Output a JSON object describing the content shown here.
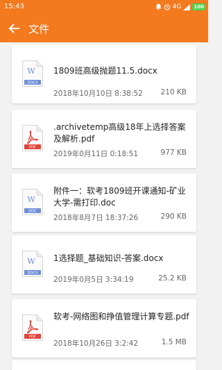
{
  "status_bar": {
    "time": "15:43",
    "network": "4G",
    "battery": "100"
  },
  "app_bar": {
    "title": "文件",
    "back_icon": "arrow-left-icon"
  },
  "colors": {
    "accent": "#f47a1f",
    "word_icon": "#6f8fd6",
    "pdf_icon": "#e0443a"
  },
  "files": [
    {
      "name": "1809班高级抛题11.5.docx",
      "date": "2018年10月10日 8:38:52",
      "size": "210 KB",
      "icon_type": "word",
      "icon_label": "DOCX"
    },
    {
      "name": ".archivetemp高级18年上选择答案及解析.pdf",
      "date": "2019年0月11日 0:18:51",
      "size": "977 KB",
      "icon_type": "pdf",
      "icon_label": "PDF"
    },
    {
      "name": "附件一：软考1809班开课通知-矿业大学-需打印.doc",
      "date": "2018年8月7日 18:37:26",
      "size": "290 KB",
      "icon_type": "word",
      "icon_label": "DOC"
    },
    {
      "name": "1选择题_基础知识-答案.docx",
      "date": "2019年0月5日 3:34:19",
      "size": "25.2 KB",
      "icon_type": "word",
      "icon_label": "DOCX"
    },
    {
      "name": "软考-网络图和挣值管理计算专题.pdf",
      "date": "2018年10月26日 3:2:42",
      "size": "1.5 MB",
      "icon_type": "pdf",
      "icon_label": "PDF"
    }
  ]
}
